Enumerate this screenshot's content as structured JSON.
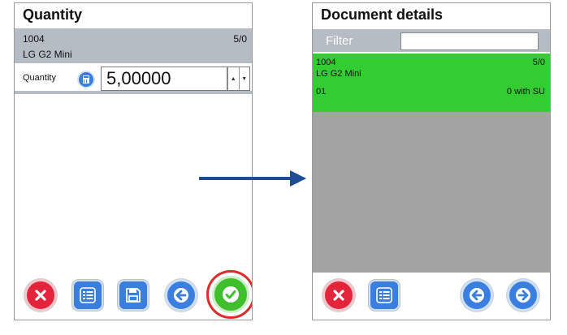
{
  "left_screen": {
    "title": "Quantity",
    "item": {
      "code": "1004",
      "count": "5/0",
      "name": "LG G2 Mini"
    },
    "quantity": {
      "label": "Quantity",
      "value": "5,00000",
      "up": "▲",
      "down": "▼"
    },
    "toolbar": {
      "cancel_icon": "close-icon",
      "list_icon": "list-icon",
      "save_icon": "save-icon",
      "back_icon": "arrow-left-icon",
      "confirm_icon": "checkmark-icon"
    }
  },
  "right_screen": {
    "title": "Document details",
    "filter": {
      "label": "Filter",
      "value": ""
    },
    "row": {
      "code": "1004",
      "count": "5/0",
      "name": "LG G2 Mini",
      "location": "01",
      "su": "0 with SU"
    },
    "toolbar": {
      "cancel_icon": "close-icon",
      "list_icon": "list-icon",
      "back_icon": "arrow-left-icon",
      "forward_icon": "arrow-right-icon"
    }
  },
  "colors": {
    "header_grey": "#b5bcc4",
    "selected_green": "#33cc33",
    "empty_grey": "#a3a3a3",
    "accent_blue": "#3a7ee0",
    "cancel_red": "#e3243b",
    "confirm_green": "#3fbf2e",
    "highlight_ring": "#e02a2a",
    "arrow": "#1f4c94"
  }
}
